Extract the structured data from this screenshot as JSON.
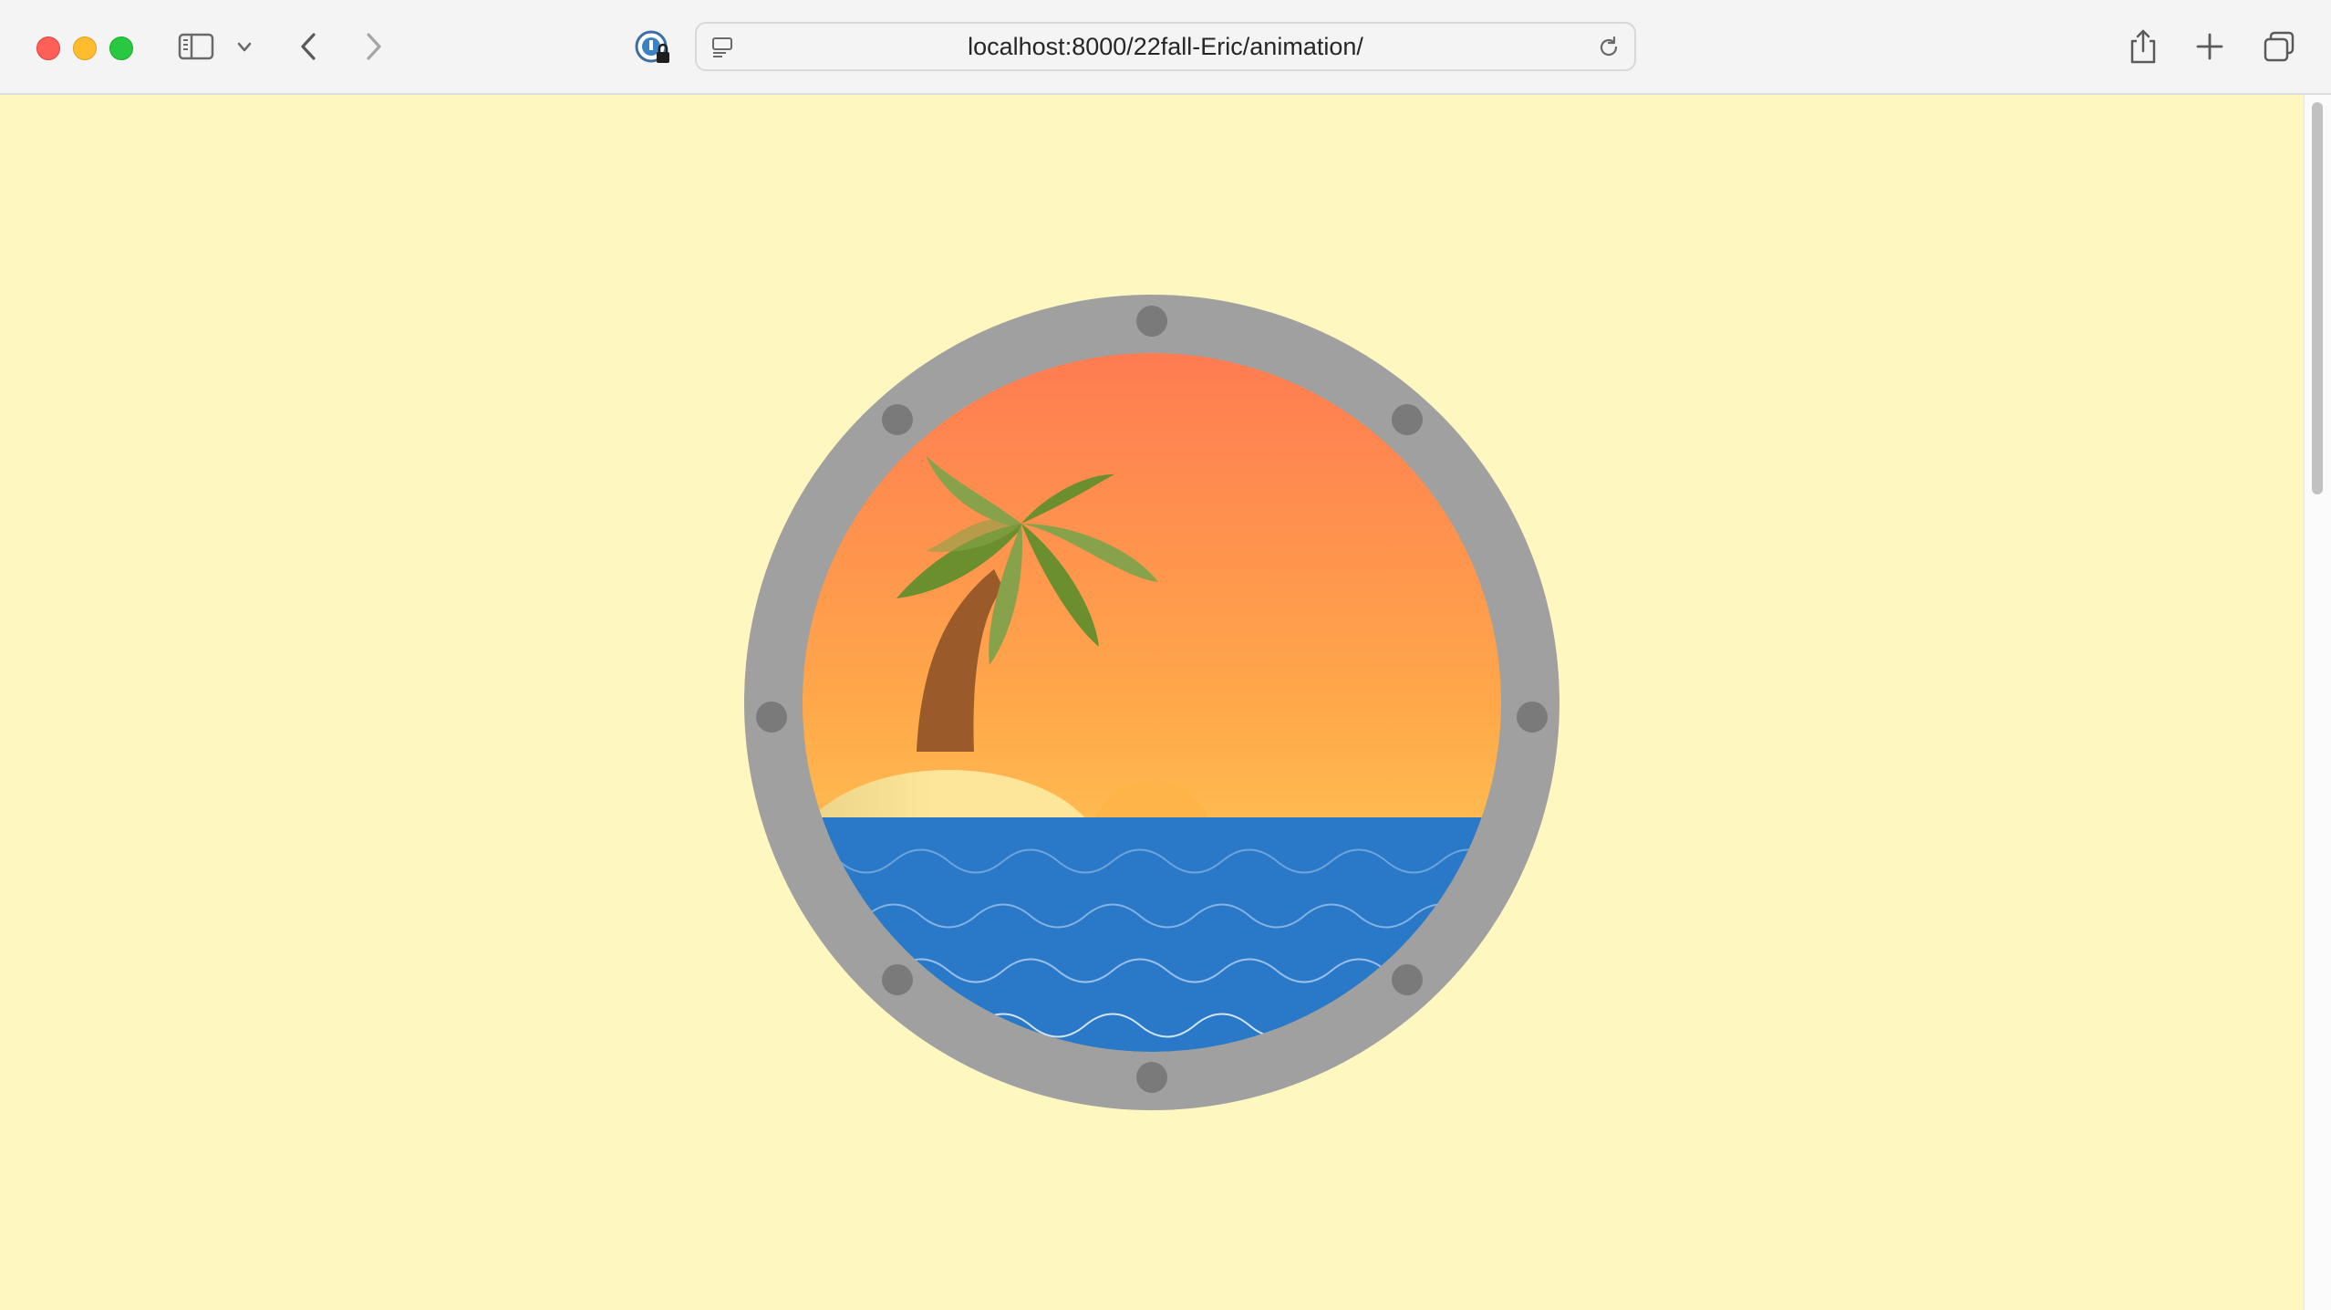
{
  "browser": {
    "url": "localhost:8000/22fall-Eric/animation/",
    "icons": [
      "close-window",
      "minimize-window",
      "zoom-window",
      "sidebar-toggle",
      "chevron-down",
      "back-arrow",
      "forward-arrow",
      "password-manager-lock",
      "page-menu",
      "reload",
      "share",
      "new-tab-plus",
      "tab-overview"
    ]
  },
  "scene": {
    "description_icons": [
      "porthole-ring",
      "bolt",
      "sunset-sky",
      "palm-tree",
      "sand-island",
      "setting-sun",
      "ocean",
      "wave"
    ],
    "colors": {
      "background": "#fff7c0",
      "ring": "#a0a0a0",
      "bolt": "#7a7a7a",
      "sky_top": "#ff7a52",
      "sky_bottom": "#ffd95a",
      "ocean": "#2a79c8",
      "sun": "#ffb44a",
      "sand": "#fde59a",
      "trunk": "#9a5a2a",
      "leaf_dark": "#6b8e2e",
      "leaf_light": "#87a24a"
    }
  }
}
